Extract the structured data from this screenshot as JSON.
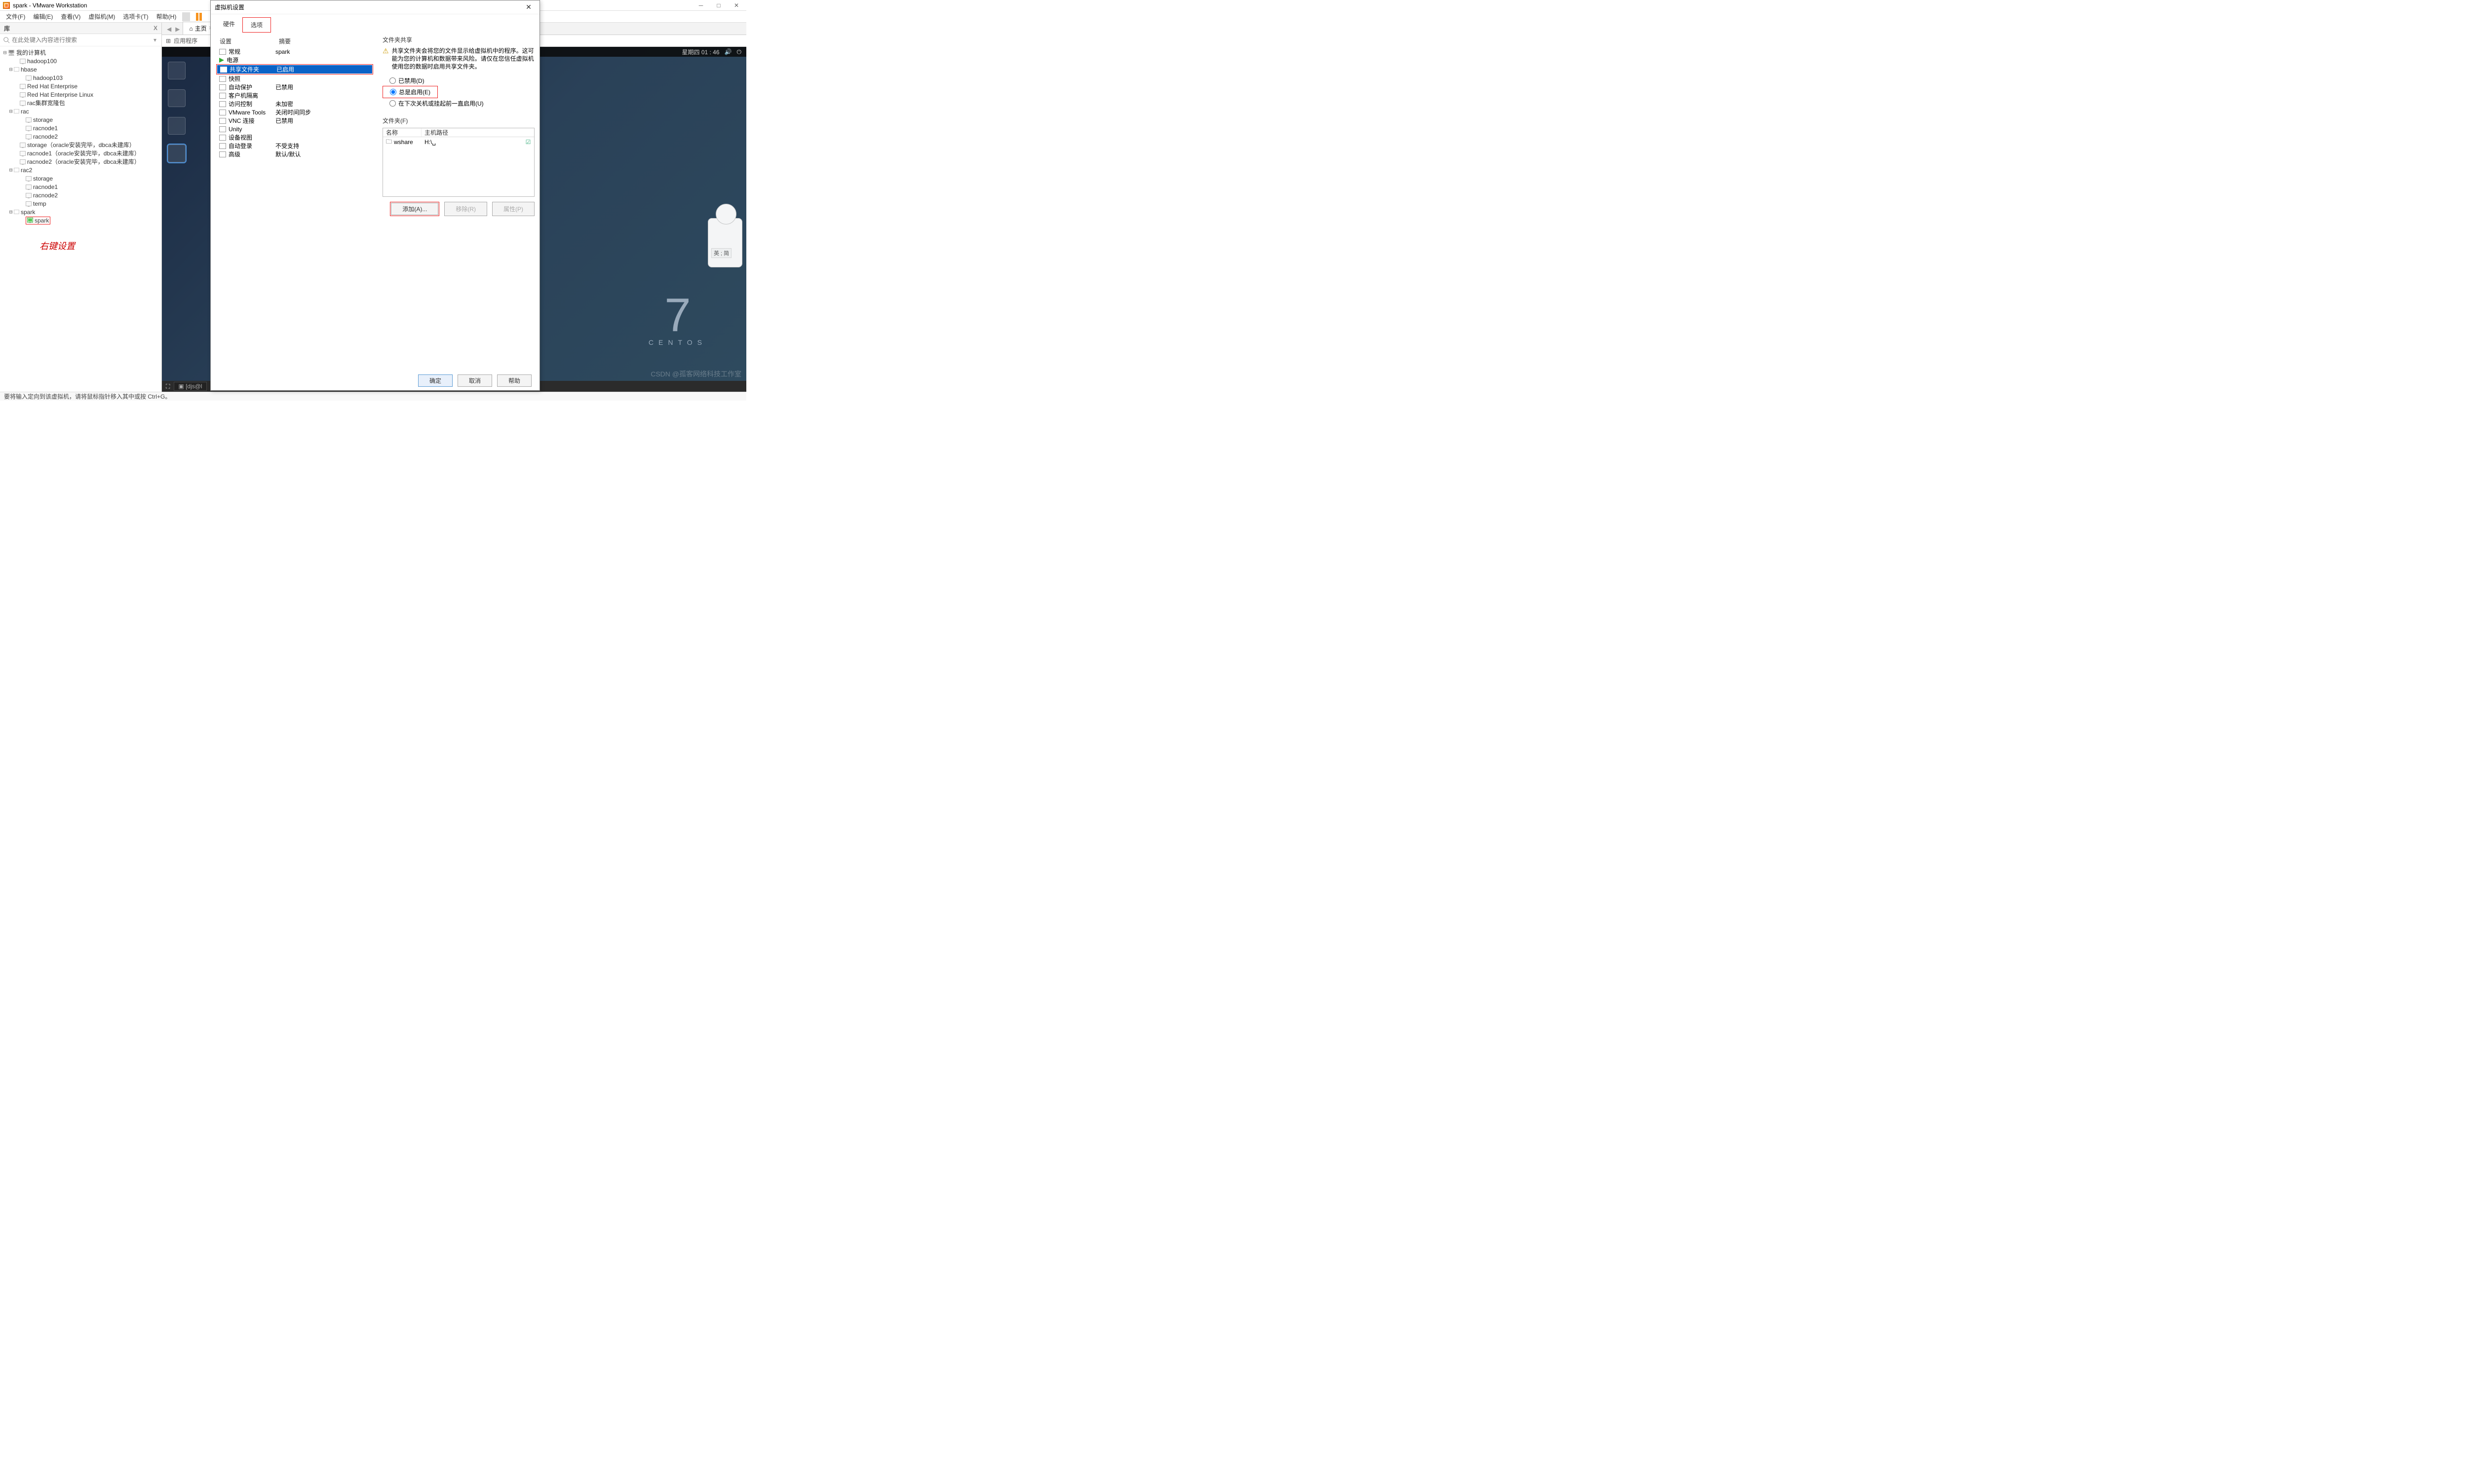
{
  "app": {
    "title": "spark - VMware Workstation"
  },
  "menu": {
    "file": "文件(F)",
    "edit": "编辑(E)",
    "view": "查看(V)",
    "vm": "虚拟机(M)",
    "tabs": "选项卡(T)",
    "help": "帮助(H)"
  },
  "library": {
    "title": "库",
    "close": "X",
    "search_placeholder": "在此处键入内容进行搜索",
    "annotation": "右键设置",
    "root": "我的计算机",
    "items": {
      "hadoop100": "hadoop100",
      "hbase": "hbase",
      "hadoop103": "hadoop103",
      "rhe": "Red Hat Enterprise",
      "rhel": "Red Hat Enterprise Linux",
      "racgrp": "rac集群宽隆包",
      "rac": "rac",
      "storage": "storage",
      "racnode1": "racnode1",
      "racnode2": "racnode2",
      "storage_oracle": "storage（oracle安装完毕，dbca未建库）",
      "racnode1_oracle": "racnode1（oracle安装完毕，dbca未建库）",
      "racnode2_oracle": "racnode2（oracle安装完毕，dbca未建库）",
      "rac2": "rac2",
      "temp": "temp",
      "spark": "spark",
      "spark_vm": "spark"
    }
  },
  "tabs": {
    "home": "主页",
    "apps": "应用程序"
  },
  "vm": {
    "clock": "星期四 01 : 46",
    "centos_num": "7",
    "centos_txt": "CENTOS",
    "terminal_tab": "[djs@l",
    "input_label": "英 ; 简",
    "watermark": "CSDN @孤客网络科技工作室"
  },
  "status": {
    "text": "要将输入定向到该虚拟机，请将鼠标指针移入其中或按 Ctrl+G。"
  },
  "dialog": {
    "title": "虚拟机设置",
    "tab_hw": "硬件",
    "tab_opt": "选项",
    "col_setting": "设置",
    "col_summary": "摘要",
    "rows": [
      {
        "k": "general",
        "label": "常规",
        "summary": "spark"
      },
      {
        "k": "power",
        "label": "电源",
        "summary": "",
        "play": true
      },
      {
        "k": "shared",
        "label": "共享文件夹",
        "summary": "已启用",
        "selected": true
      },
      {
        "k": "snapshot",
        "label": "快照",
        "summary": ""
      },
      {
        "k": "autoprotect",
        "label": "自动保护",
        "summary": "已禁用"
      },
      {
        "k": "guest",
        "label": "客户机隔离",
        "summary": ""
      },
      {
        "k": "access",
        "label": "访问控制",
        "summary": "未加密"
      },
      {
        "k": "tools",
        "label": "VMware Tools",
        "summary": "关闭时间同步"
      },
      {
        "k": "vnc",
        "label": "VNC 连接",
        "summary": "已禁用"
      },
      {
        "k": "unity",
        "label": "Unity",
        "summary": ""
      },
      {
        "k": "device",
        "label": "设备视图",
        "summary": ""
      },
      {
        "k": "autologin",
        "label": "自动登录",
        "summary": "不受支持"
      },
      {
        "k": "adv",
        "label": "高级",
        "summary": "默认/默认"
      }
    ],
    "share": {
      "group": "文件夹共享",
      "warning": "共享文件夹会将您的文件显示给虚拟机中的程序。这可能为您的计算机和数据带来风险。请仅在您信任虚拟机使用您的数据时启用共享文件夹。",
      "r_disabled": "已禁用(D)",
      "r_always": "总是启用(E)",
      "r_next": "在下次关机或挂起前一直启用(U)"
    },
    "folders": {
      "group": "文件夹(F)",
      "col_name": "名称",
      "col_path": "主机路径",
      "row_name": "wshare",
      "row_path": "H:\\␣",
      "add": "添加(A)...",
      "remove": "移除(R)",
      "props": "属性(P)"
    },
    "ok": "确定",
    "cancel": "取消",
    "help": "帮助"
  }
}
